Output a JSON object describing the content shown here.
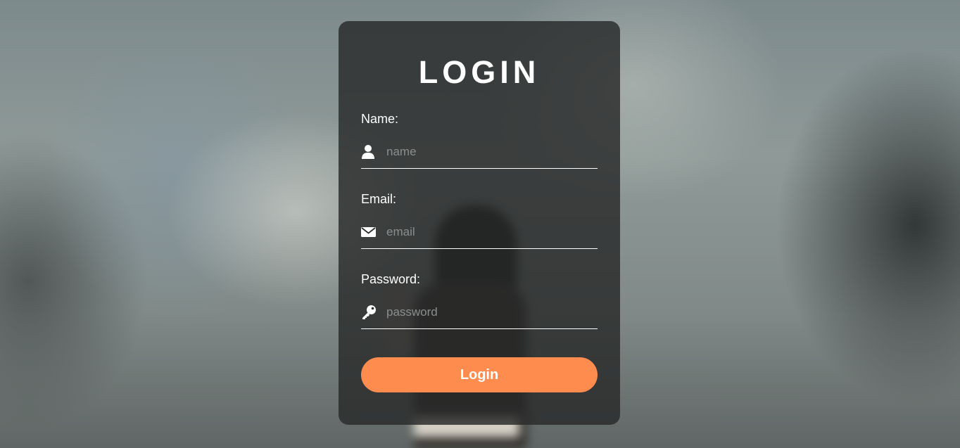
{
  "form": {
    "title": "LOGIN",
    "fields": [
      {
        "label": "Name:",
        "placeholder": "name",
        "icon": "user-icon",
        "value": ""
      },
      {
        "label": "Email:",
        "placeholder": "email",
        "icon": "envelope-icon",
        "value": ""
      },
      {
        "label": "Password:",
        "placeholder": "password",
        "icon": "key-icon",
        "value": ""
      }
    ],
    "submit_label": "Login"
  },
  "colors": {
    "button": "#ff8c4f",
    "card": "rgba(40,42,42,0.82)",
    "text": "#ffffff",
    "placeholder": "#8a8e8f"
  }
}
